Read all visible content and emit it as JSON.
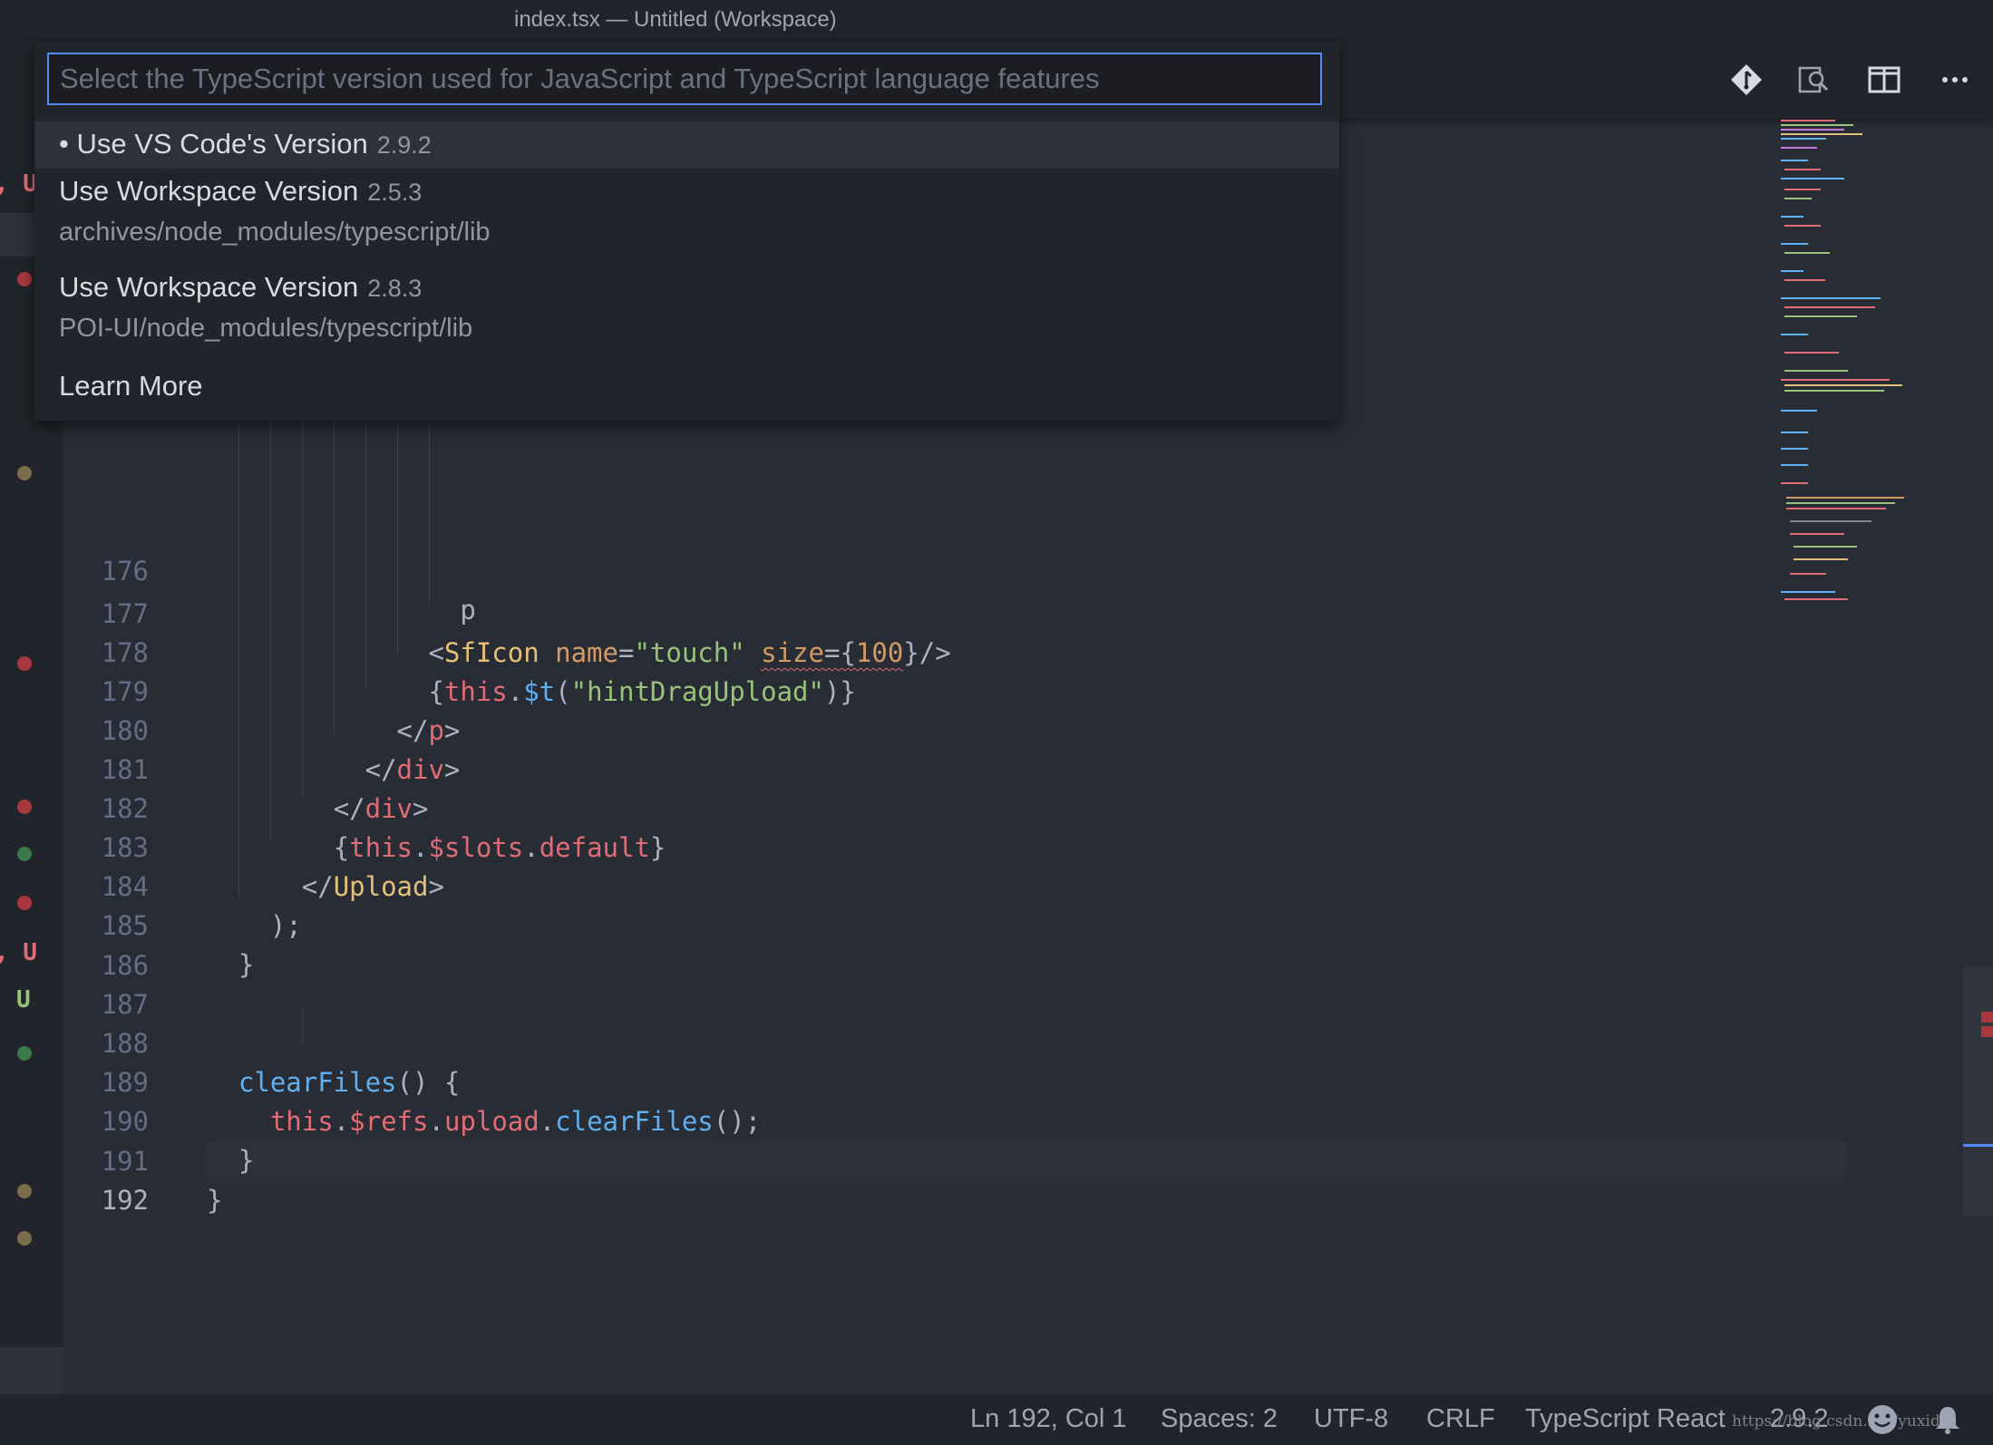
{
  "window": {
    "title": "index.tsx — Untitled (Workspace)"
  },
  "toolbar": {
    "icons": [
      "git-compare-icon",
      "open-preview-icon",
      "split-editor-icon",
      "more-actions-icon"
    ]
  },
  "quick_pick": {
    "placeholder": "Select the TypeScript version used for JavaScript and TypeScript language features",
    "items": [
      {
        "label": "• Use VS Code's Version",
        "description": "2.9.2",
        "detail": ""
      },
      {
        "label": "Use Workspace Version",
        "description": "2.5.3",
        "detail": "archives/node_modules/typescript/lib"
      },
      {
        "label": "Use Workspace Version",
        "description": "2.8.3",
        "detail": "POI-UI/node_modules/typescript/lib"
      },
      {
        "label": "Learn More",
        "description": "",
        "detail": ""
      }
    ]
  },
  "gutter": {
    "letters": [
      ", U",
      ", U",
      "U"
    ]
  },
  "editor": {
    "line_numbers": [
      "176",
      "177",
      "178",
      "179",
      "180",
      "181",
      "182",
      "183",
      "184",
      "185",
      "186",
      "187",
      "188",
      "189",
      "190",
      "191",
      "192"
    ],
    "current_line": "192"
  },
  "status_bar": {
    "position": "Ln 192, Col 1",
    "indentation": "Spaces: 2",
    "encoding": "UTF-8",
    "line_ending": "CRLF",
    "language": "TypeScript React",
    "ts_version": "2.9.2",
    "watermark": "https://blog.csdn.net/yuxidl"
  },
  "colors": {
    "accent": "#568af2",
    "error": "#e06c75",
    "added": "#98c379"
  }
}
